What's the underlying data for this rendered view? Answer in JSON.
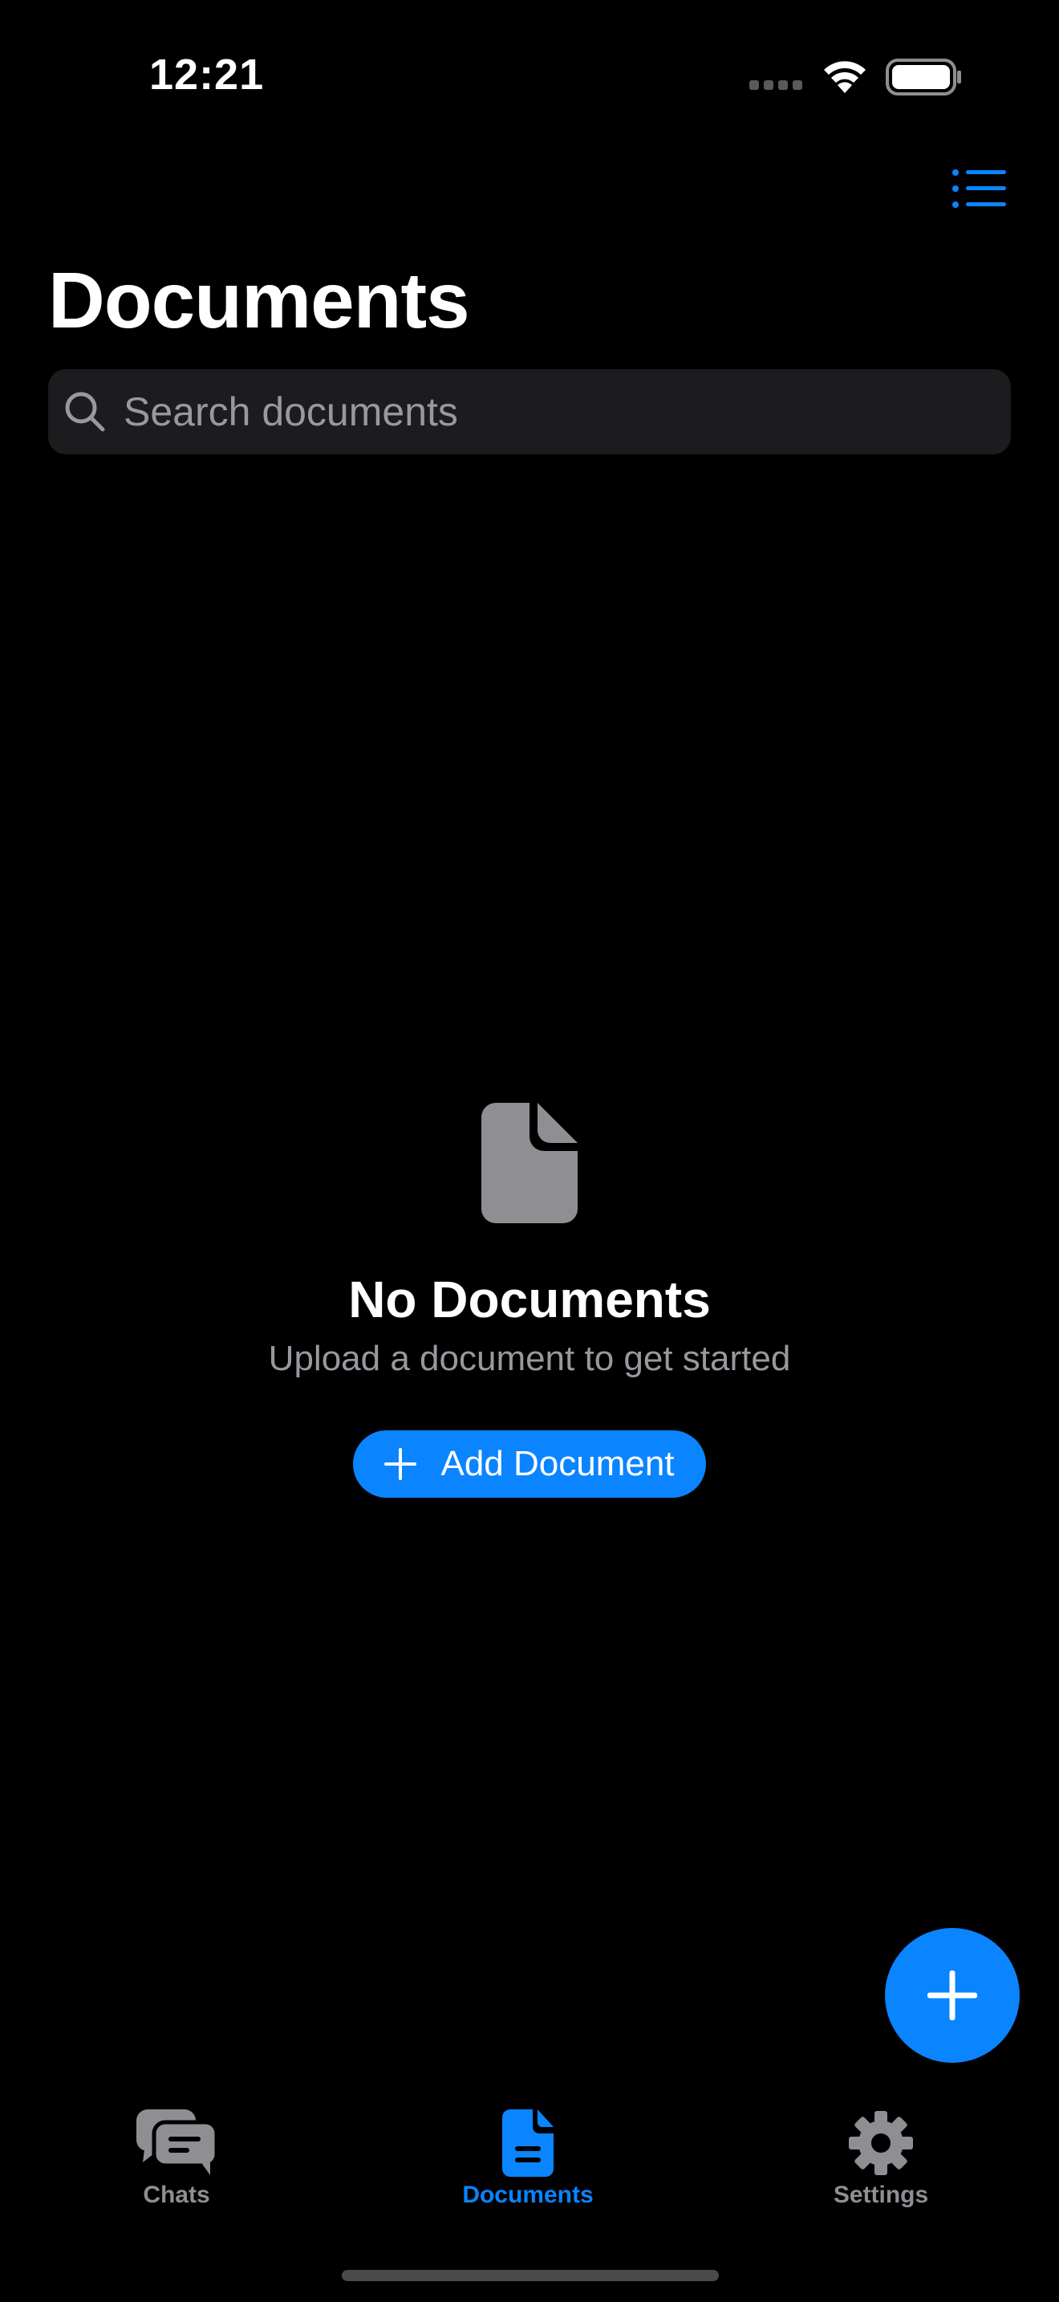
{
  "status_bar": {
    "time": "12:21"
  },
  "header": {
    "title": "Documents",
    "list_view_icon": "list-icon"
  },
  "search": {
    "placeholder": "Search documents",
    "value": ""
  },
  "empty_state": {
    "icon": "document-icon",
    "title": "No Documents",
    "subtitle": "Upload a document to get started",
    "add_button_label": "Add Document"
  },
  "fab": {
    "icon": "plus-icon"
  },
  "tab_bar": {
    "tabs": [
      {
        "label": "Chats",
        "icon": "chat-bubbles-icon",
        "active": false
      },
      {
        "label": "Documents",
        "icon": "document-icon",
        "active": true
      },
      {
        "label": "Settings",
        "icon": "gear-icon",
        "active": false
      }
    ]
  },
  "colors": {
    "accent": "#0a84ff",
    "background": "#000000",
    "search_background": "#1c1c1e",
    "secondary_text": "#98989f",
    "inactive_tab": "#8e8e93"
  }
}
